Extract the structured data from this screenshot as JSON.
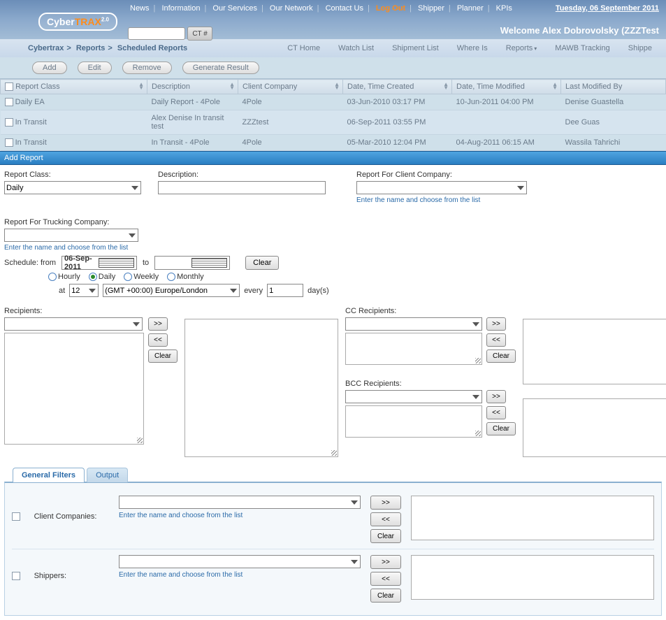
{
  "header": {
    "date": "Tuesday, 06 September 2011",
    "welcome": "Welcome Alex Dobrovolsky (ZZZTest",
    "logo_cyber": "Cyber",
    "logo_trax": "TRAX",
    "logo_ver": "2.0",
    "search_btn": "CT #"
  },
  "nav": {
    "items": [
      "News",
      "Information",
      "Our Services",
      "Our Network",
      "Contact Us",
      "Log Out",
      "Shipper",
      "Planner",
      "KPIs"
    ],
    "logout_index": 5
  },
  "breadcrumb": {
    "a": "Cybertrax",
    "b": "Reports",
    "c": "Scheduled Reports"
  },
  "subnav": [
    "CT Home",
    "Watch List",
    "Shipment List",
    "Where Is",
    "Reports",
    "MAWB Tracking",
    "Shippe"
  ],
  "toolbar": {
    "add": "Add",
    "edit": "Edit",
    "remove": "Remove",
    "gen": "Generate Result"
  },
  "grid_headers": [
    "Report Class",
    "Description",
    "Client Company",
    "Date, Time Created",
    "Date, Time Modified",
    "Last Modified By"
  ],
  "grid_rows": [
    [
      "Daily EA",
      "Daily Report - 4Pole",
      "4Pole",
      "03-Jun-2010 03:17 PM",
      "10-Jun-2011 04:00 PM",
      "Denise Guastella"
    ],
    [
      "In Transit",
      "Alex Denise In transit test",
      "ZZZtest",
      "06-Sep-2011 03:55 PM",
      "",
      "Dee Guas"
    ],
    [
      "In Transit",
      "In Transit - 4Pole",
      "4Pole",
      "05-Mar-2010 12:04 PM",
      "04-Aug-2011 06:15 AM",
      "Wassila Tahrichi"
    ]
  ],
  "section_title": "Add Report",
  "form": {
    "report_class_lbl": "Report Class:",
    "report_class_val": "Daily",
    "description_lbl": "Description:",
    "client_lbl": "Report For Client Company:",
    "trucking_lbl": "Report For Trucking Company:",
    "hint": "Enter the name and choose from the list",
    "sched_from": "Schedule: from",
    "from_date": "06-Sep-2011",
    "to": "to",
    "clear": "Clear",
    "hourly": "Hourly",
    "daily": "Daily",
    "weekly": "Weekly",
    "monthly": "Monthly",
    "at": "at",
    "hour_val": "12",
    "tz_val": "(GMT +00:00) Europe/London",
    "every": "every",
    "every_val": "1",
    "days": "day(s)",
    "recip_lbl": "Recipients:",
    "cc_lbl": "CC Recipients:",
    "bcc_lbl": "BCC Recipients:",
    "btn_right": ">>",
    "btn_left": "<<"
  },
  "tabs": {
    "general": "General Filters",
    "output": "Output"
  },
  "filters": {
    "client": "Client Companies:",
    "shippers": "Shippers:",
    "hint": "Enter the name and choose from the list",
    "btn_right": ">>",
    "btn_left": "<<",
    "btn_clear": "Clear"
  }
}
